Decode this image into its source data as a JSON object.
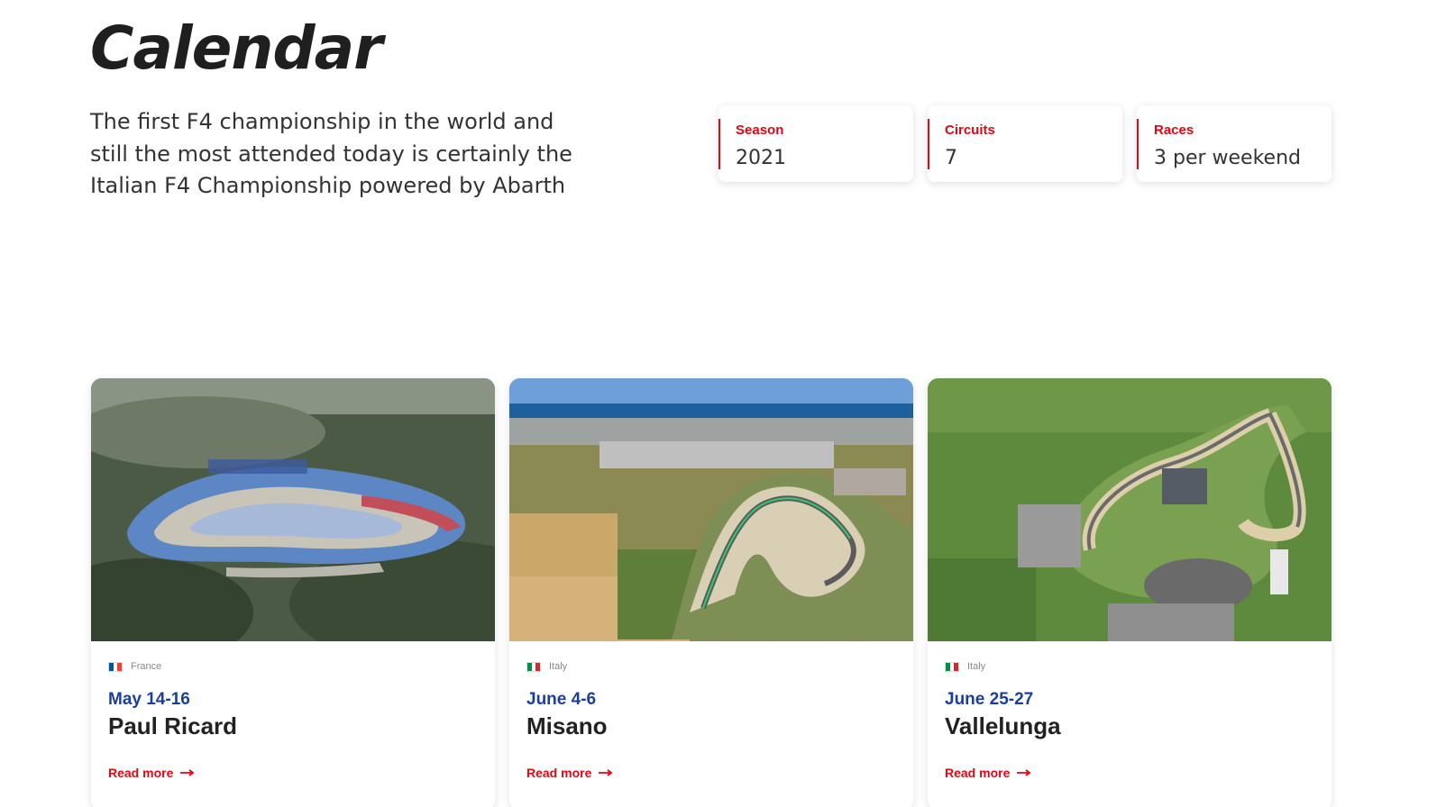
{
  "header": {
    "title": "Calendar",
    "intro": "The first F4 championship in the world and still the most attended today is certainly the Italian F4 Championship powered by Abarth"
  },
  "stats": [
    {
      "label": "Season",
      "value": "2021"
    },
    {
      "label": "Circuits",
      "value": "7"
    },
    {
      "label": "Races",
      "value": "3 per weekend"
    }
  ],
  "events": [
    {
      "country": "France",
      "flag_colors": [
        "#0055a4",
        "#ffffff",
        "#ef4135"
      ],
      "date": "May 14-16",
      "circuit": "Paul Ricard",
      "link_label": "Read more",
      "image": "aerial-circuit-photo"
    },
    {
      "country": "Italy",
      "flag_colors": [
        "#009246",
        "#ffffff",
        "#ce2b37"
      ],
      "date": "June 4-6",
      "circuit": "Misano",
      "link_label": "Read more",
      "image": "aerial-circuit-photo"
    },
    {
      "country": "Italy",
      "flag_colors": [
        "#009246",
        "#ffffff",
        "#ce2b37"
      ],
      "date": "June 25-27",
      "circuit": "Vallelunga",
      "link_label": "Read more",
      "image": "aerial-circuit-photo"
    }
  ],
  "colors": {
    "accent": "#e30613",
    "date_blue": "#1c3f99",
    "text": "#222222"
  }
}
